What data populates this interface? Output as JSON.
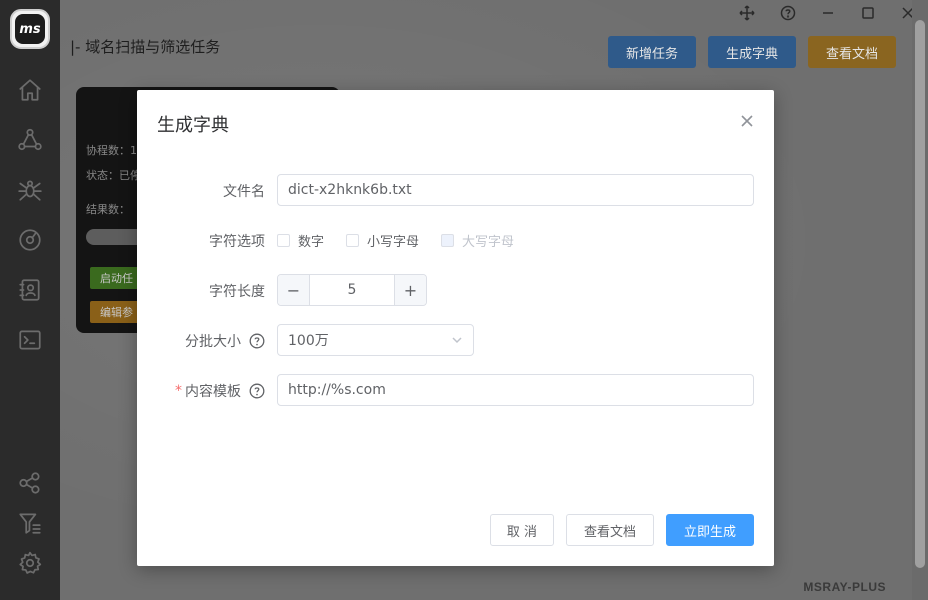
{
  "app": {
    "logo_text": "ms",
    "page_title": "|- 域名扫描与筛选任务",
    "watermark": "MSRAY-PLUS"
  },
  "header_buttons": {
    "new_task": "新增任务",
    "generate_dict": "生成字典",
    "view_docs": "查看文档"
  },
  "sidebar": {
    "icons": [
      "home-icon",
      "network-nodes-icon",
      "spider-icon",
      "compass-icon",
      "contacts-icon",
      "terminal-icon",
      "share-icon",
      "filter-list-icon",
      "gear-icon"
    ]
  },
  "task_card": {
    "coroutines_label": "协程数：1",
    "status_label": "状态：已停",
    "results_label": "结果数：",
    "start_button": "启动任",
    "edit_button": "编辑参"
  },
  "modal": {
    "title": "生成字典",
    "filename": {
      "label": "文件名",
      "value": "dict-x2hknk6b.txt"
    },
    "char_options": {
      "label": "字符选项",
      "options": [
        {
          "label": "数字",
          "checked": false,
          "disabled": false
        },
        {
          "label": "小写字母",
          "checked": false,
          "disabled": false
        },
        {
          "label": "大写字母",
          "checked": false,
          "disabled": true
        }
      ]
    },
    "char_length": {
      "label": "字符长度",
      "value": "5",
      "minus": "−",
      "plus": "+"
    },
    "batch_size": {
      "label": "分批大小",
      "value": "100万"
    },
    "content_template": {
      "label": "内容模板",
      "required_mark": "*",
      "value": "http://%s.com"
    },
    "buttons": {
      "cancel": "取 消",
      "view_docs": "查看文档",
      "generate": "立即生成"
    }
  },
  "colors": {
    "primary": "#409eff",
    "sidebar_bg": "#2b2b2b",
    "required": "#f56c6c"
  }
}
